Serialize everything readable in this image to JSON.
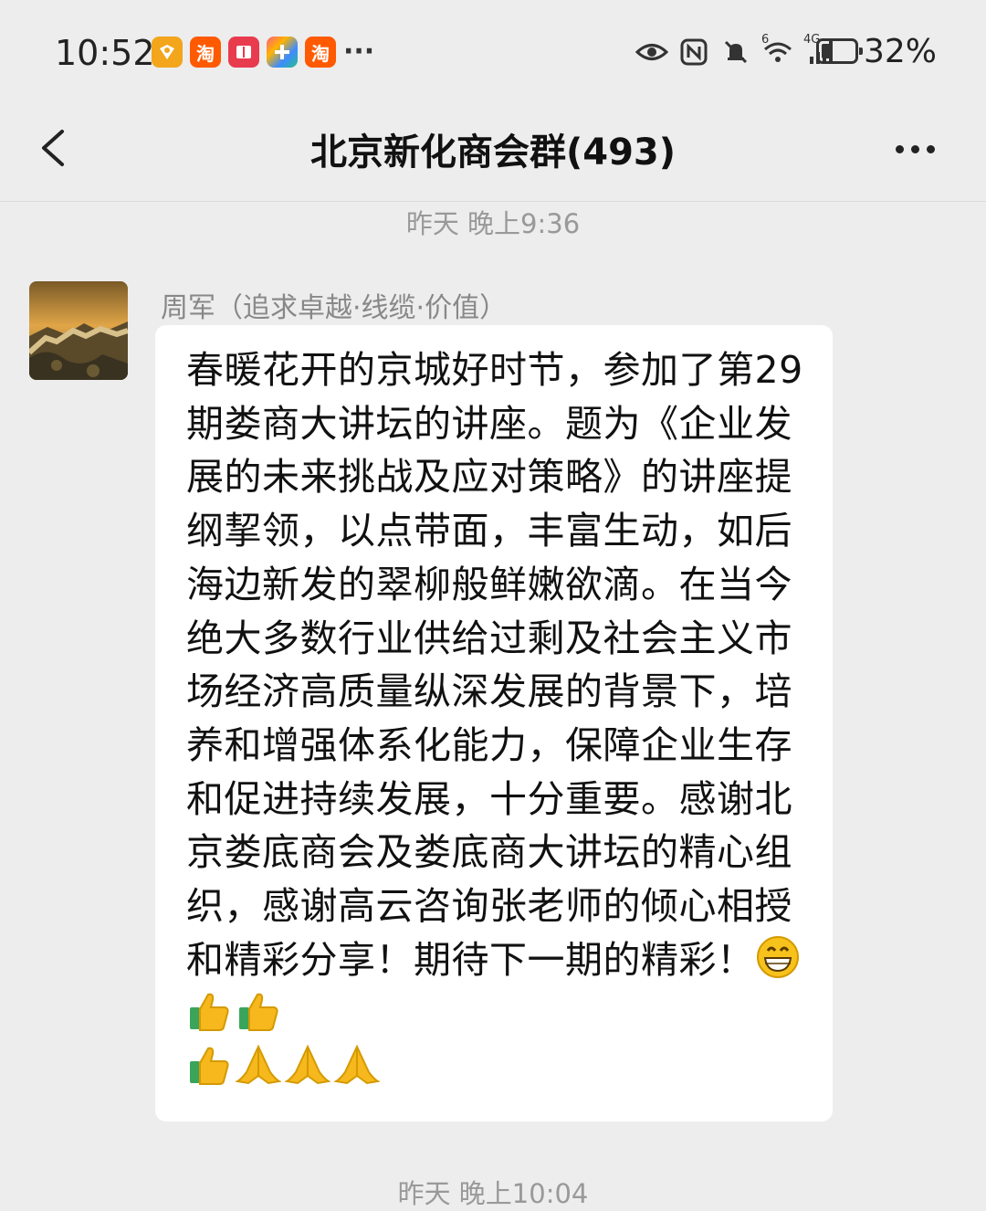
{
  "status_bar": {
    "time": "10:52",
    "notification_icons": [
      {
        "name": "app-yellow-icon",
        "label": "",
        "color": "#f3a51b"
      },
      {
        "name": "taobao-icon",
        "label": "淘",
        "color": "#ff5a00"
      },
      {
        "name": "book-app-icon",
        "label": "",
        "color": "#e83b4e"
      },
      {
        "name": "colorful-app-icon",
        "label": "",
        "color": "#3d8bff"
      },
      {
        "name": "taobao-icon-2",
        "label": "淘",
        "color": "#ff5a00"
      }
    ],
    "more_indicator": "···",
    "network_labels": {
      "wifi": "6",
      "cellular": "4G"
    },
    "battery_percent": "32%",
    "battery_level": 0.32
  },
  "header": {
    "title": "北京新化商会群(493)"
  },
  "chat": {
    "timestamp_1": "昨天 晚上9:36",
    "message": {
      "sender": "周军（追求卓越·线缆·价值）",
      "text": "春暖花开的京城好时节，参加了第29 期娄商大讲坛的讲座。题为《企业发展的未来挑战及应对策略》的讲座提纲挈领，以点带面，丰富生动，如后海边新发的翠柳般鲜嫩欲滴。在当今绝大多数行业供给过剩及社会主义市场经济高质量纵深发展的背景下，培养和增强体系化能力，保障企业生存和促进持续发展，十分重要。感谢北京娄底商会及娄底商大讲坛的精心组织，感谢高云咨询张老师的倾心相授和精彩分享！期待下一期的精彩！",
      "emojis": [
        "grin",
        "thumbs-up",
        "thumbs-up",
        "thumbs-up",
        "pray",
        "pray",
        "pray"
      ]
    },
    "timestamp_2": "昨天 晚上10:04"
  },
  "colors": {
    "background": "#ededed",
    "bubble": "#ffffff",
    "timestamp": "#999999",
    "sender": "#888888"
  }
}
